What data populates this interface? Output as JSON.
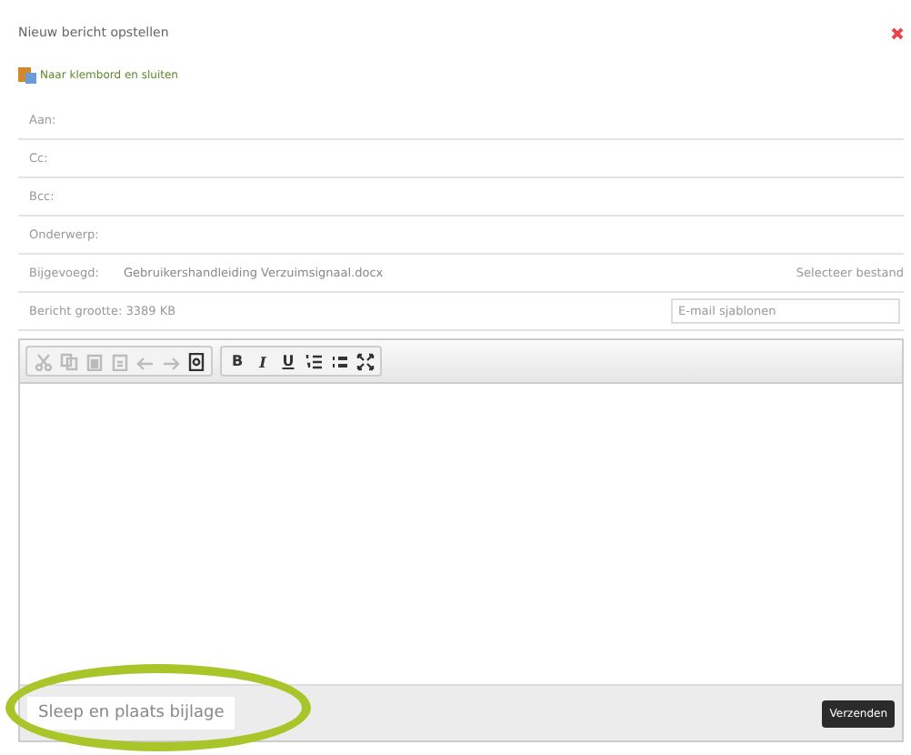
{
  "dialog": {
    "title": "Nieuw bericht opstellen"
  },
  "clipboard_link": "Naar klembord en sluiten",
  "fields": [
    {
      "label": "Aan:"
    },
    {
      "label": "Cc:"
    },
    {
      "label": "Bcc:"
    },
    {
      "label": "Onderwerp:"
    }
  ],
  "attachment": {
    "label": "Bijgevoegd:",
    "file": "Gebruikershandleiding Verzuimsignaal.docx",
    "select": "Selecteer bestand"
  },
  "size": {
    "label": "Bericht grootte: 3389 KB",
    "templates_placeholder": "E-mail sjablonen"
  },
  "toolbar": [
    [
      {
        "kind": "cut",
        "disabled": true
      },
      {
        "kind": "copy",
        "disabled": true
      },
      {
        "kind": "paste",
        "disabled": true
      },
      {
        "kind": "paste-text",
        "disabled": true
      },
      {
        "kind": "undo",
        "disabled": true
      },
      {
        "kind": "redo",
        "disabled": true
      },
      {
        "kind": "preview",
        "disabled": false
      }
    ],
    [
      {
        "kind": "bold",
        "label": "B",
        "disabled": false
      },
      {
        "kind": "italic",
        "label": "I",
        "disabled": false
      },
      {
        "kind": "underline",
        "label": "U",
        "disabled": false
      },
      {
        "kind": "numbered-list",
        "disabled": false
      },
      {
        "kind": "bulleted-list",
        "disabled": false
      },
      {
        "kind": "maximize",
        "disabled": false
      }
    ]
  ],
  "footer": {
    "drop_zone": "Sleep en plaats bijlage",
    "send": "Verzenden"
  }
}
